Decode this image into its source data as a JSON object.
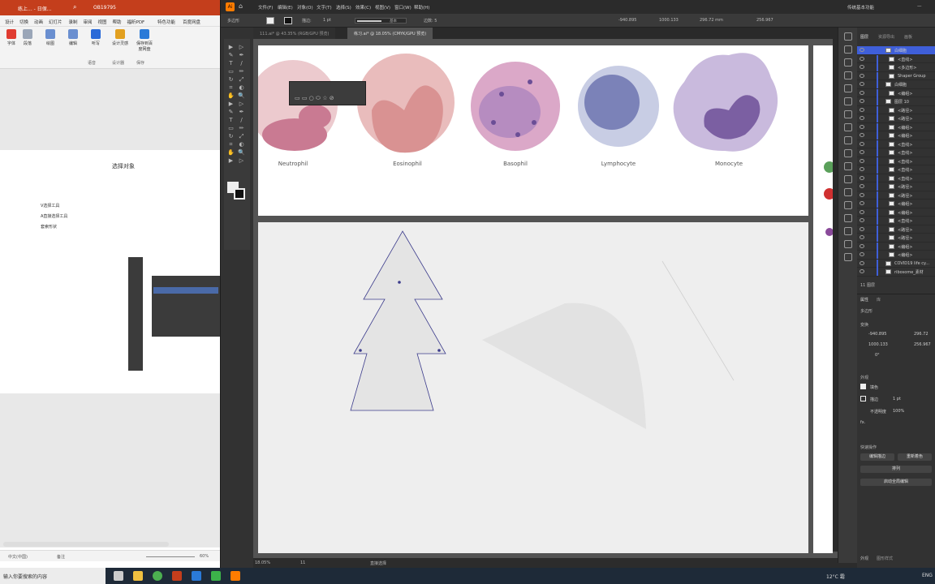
{
  "ppt": {
    "title_left": "练上... - 日保...",
    "title_mid": "OB19795",
    "tabs": [
      "设计",
      "切换",
      "动画",
      "幻灯片",
      "录制",
      "审阅",
      "视图",
      "帮助",
      "福昕PDF",
      "特色功能",
      "百度网盘"
    ],
    "ribbon": [
      {
        "label": "字体",
        "color": "#e03c31"
      },
      {
        "label": "段落",
        "color": "#9aa6b8"
      },
      {
        "label": "绘图",
        "color": "#6a8fd0"
      },
      {
        "label": "编辑",
        "color": "#6a8fd0"
      },
      {
        "label": "听写",
        "color": "#2a6ad8"
      },
      {
        "label": "设计灵感",
        "color": "#e2a020"
      },
      {
        "label": "保存到百度网盘",
        "color": "#2a7ad8"
      }
    ],
    "ribbon_groups": [
      "语音",
      "设计器",
      "保存"
    ],
    "slide": {
      "title": "选择对象",
      "lines": [
        "V选择工具",
        "A直接选择工具",
        "套索形状"
      ]
    },
    "status": {
      "lang": "中文(中国)",
      "notes": "备注",
      "zoom": "60%"
    }
  },
  "ai": {
    "menu": [
      "文件(F)",
      "编辑(E)",
      "对象(O)",
      "文字(T)",
      "选择(S)",
      "效果(C)",
      "视图(V)",
      "窗口(W)",
      "帮助(H)"
    ],
    "workspace": "传统基本功能",
    "control": {
      "object": "多边形",
      "stroke_label": "描边:",
      "stroke_value": "1 pt",
      "style": "基本",
      "points": "边数: 5",
      "x": "-940.895",
      "y": "1000.133",
      "w": "296.72 mm",
      "h": "256.967"
    },
    "tabs": [
      {
        "label": "111.ai* @ 43.35% (RGB/GPU 预览)",
        "active": false
      },
      {
        "label": "练习.ai* @ 18.05% (CMYK/GPU 预览)",
        "active": true
      }
    ],
    "cells": [
      {
        "name": "Neutrophil",
        "fill": "#eac3c8",
        "core": "#c06e86"
      },
      {
        "name": "Eosinophil",
        "fill": "#e7b8b8",
        "core": "#d98f8f"
      },
      {
        "name": "Basophil",
        "fill": "#d9a6c6",
        "core": "#9a6aaa"
      },
      {
        "name": "Lymphocyte",
        "fill": "#c3c8e0",
        "core": "#7a80b5"
      },
      {
        "name": "Monocyte",
        "fill": "#c8b8dc",
        "core": "#7a5e9e"
      }
    ],
    "status": {
      "zoom": "18.05%",
      "page": "11",
      "tool": "直接选择"
    },
    "layers_header": [
      "图层",
      "资源导出",
      "画板"
    ],
    "layers": [
      {
        "name": "白细胞",
        "level": 0,
        "selected": true
      },
      {
        "name": "<直线>",
        "level": 1
      },
      {
        "name": "<多边形>",
        "level": 1
      },
      {
        "name": "Shaper Group",
        "level": 1
      },
      {
        "name": "白细胞",
        "level": 0
      },
      {
        "name": "<编组>",
        "level": 1
      },
      {
        "name": "图层 10",
        "level": 0
      },
      {
        "name": "<路径>",
        "level": 1
      },
      {
        "name": "<路径>",
        "level": 1
      },
      {
        "name": "<编组>",
        "level": 1
      },
      {
        "name": "<编组>",
        "level": 1
      },
      {
        "name": "<直线>",
        "level": 1
      },
      {
        "name": "<直线>",
        "level": 1
      },
      {
        "name": "<直线>",
        "level": 1
      },
      {
        "name": "<直线>",
        "level": 1
      },
      {
        "name": "<直线>",
        "level": 1
      },
      {
        "name": "<路径>",
        "level": 1
      },
      {
        "name": "<路径>",
        "level": 1
      },
      {
        "name": "<编组>",
        "level": 1
      },
      {
        "name": "<编组>",
        "level": 1
      },
      {
        "name": "<直线>",
        "level": 1
      },
      {
        "name": "<路径>",
        "level": 1
      },
      {
        "name": "<路径>",
        "level": 1
      },
      {
        "name": "<编组>",
        "level": 1
      },
      {
        "name": "<编组>",
        "level": 1
      },
      {
        "name": "COVID19 life cy...",
        "level": 0
      },
      {
        "name": "ribosome_素材",
        "level": 0
      }
    ],
    "layers_footer": "11 图层",
    "props": {
      "header": [
        "属性",
        "库"
      ],
      "section1": "多边形",
      "section2": "变换",
      "x": "-940.895",
      "y": "1000.133",
      "w": "296.72",
      "h": "256.967",
      "angle": "0°",
      "section3": "外观",
      "fill": "填色",
      "stroke": "描边",
      "stroke_value": "1 pt",
      "opacity": "不透明度",
      "opacity_value": "100%",
      "fx": "fx.",
      "section4": "快速操作",
      "btn1": "编辑描边",
      "btn2": "重新着色",
      "btn3": "排列",
      "btn4": "启动全局编辑"
    },
    "right_tabs": [
      "外观",
      "图形样式"
    ]
  },
  "taskbar": {
    "search": "输入你要搜索的内容",
    "weather": "12°C 霜",
    "lang": "ENG"
  }
}
